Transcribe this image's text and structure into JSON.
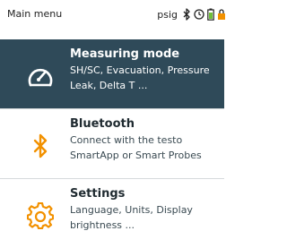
{
  "statusbar": {
    "title": "Main menu",
    "unit": "psig",
    "icons": [
      "bluetooth-icon",
      "clock-icon",
      "battery-icon",
      "lock-icon"
    ]
  },
  "menu": {
    "items": [
      {
        "title": "Measuring mode",
        "description": "SH/SC, Evacuation, Pressure Leak, Delta T ...",
        "icon": "gauge-icon",
        "selected": true
      },
      {
        "title": "Bluetooth",
        "description": "Connect with the testo SmartApp or Smart Probes",
        "icon": "bluetooth-icon",
        "selected": false
      },
      {
        "title": "Settings",
        "description": "Language, Units, Display brightness ...",
        "icon": "gear-icon",
        "selected": false
      }
    ]
  },
  "colors": {
    "selected_bg": "#2f4a59",
    "accent_orange": "#f29100",
    "battery_green": "#6fbf3a"
  }
}
